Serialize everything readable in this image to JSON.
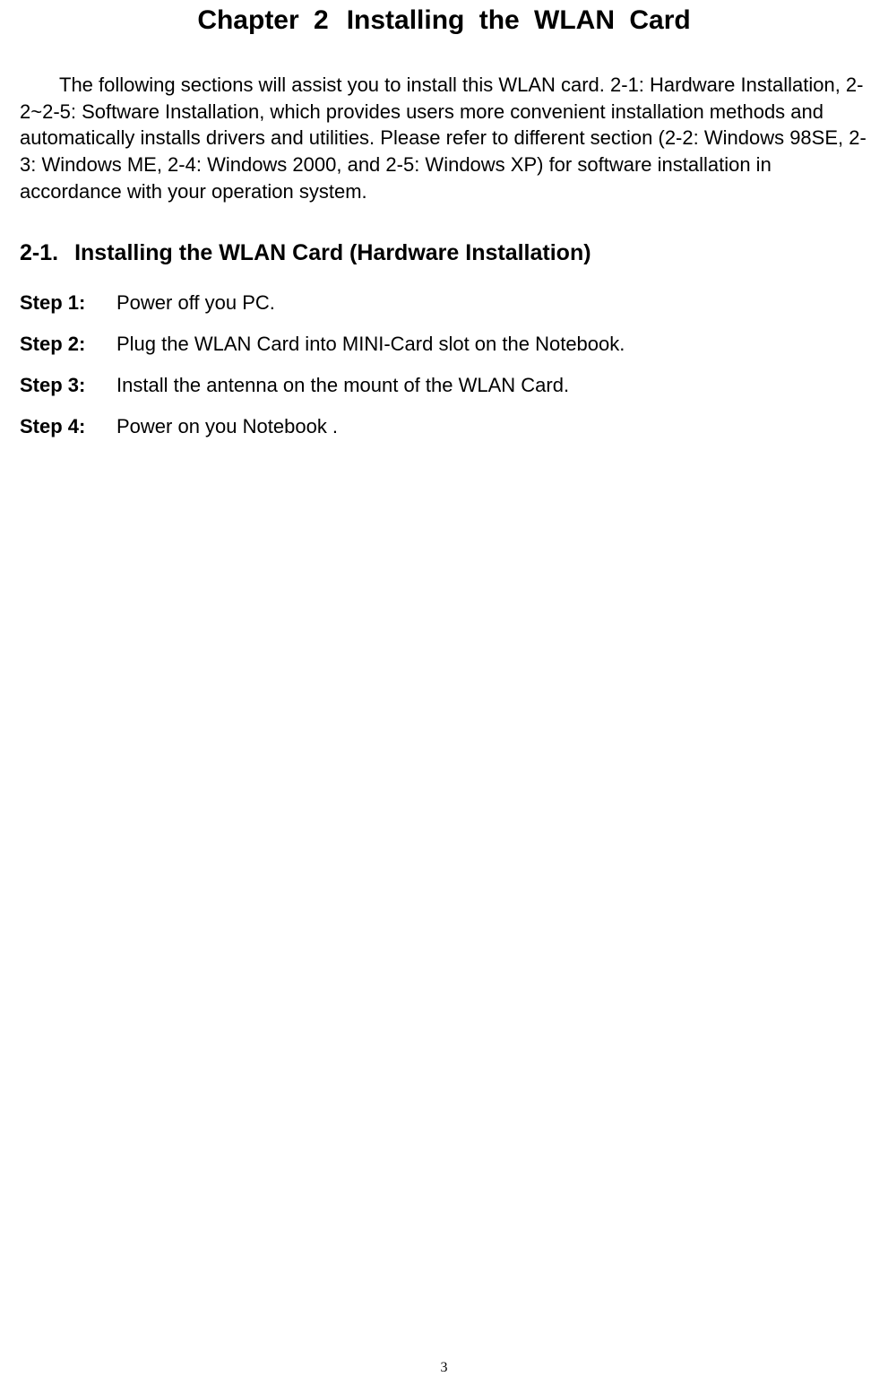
{
  "chapter": {
    "label": "Chapter 2",
    "title": "Installing the WLAN Card"
  },
  "intro": "The following sections will assist you to install this WLAN card. 2-1: Hardware Installation, 2-2~2-5: Software Installation, which provides users more convenient installation methods and automatically installs drivers and utilities. Please refer to different section (2-2: Windows 98SE, 2-3: Windows ME, 2-4: Windows 2000, and 2-5: Windows XP) for software installation in accordance with your operation system.",
  "section": {
    "number": "2-1.",
    "title": "Installing the WLAN Card (Hardware Installation)"
  },
  "steps": [
    {
      "label": "Step 1:",
      "text": "Power off you PC."
    },
    {
      "label": "Step 2:",
      "text": "Plug the WLAN Card into MINI-Card slot on the Notebook."
    },
    {
      "label": "Step 3:",
      "text": "Install the antenna on the mount of the WLAN Card."
    },
    {
      "label": "Step 4:",
      "text": "Power on you Notebook ."
    }
  ],
  "page_number": "3"
}
